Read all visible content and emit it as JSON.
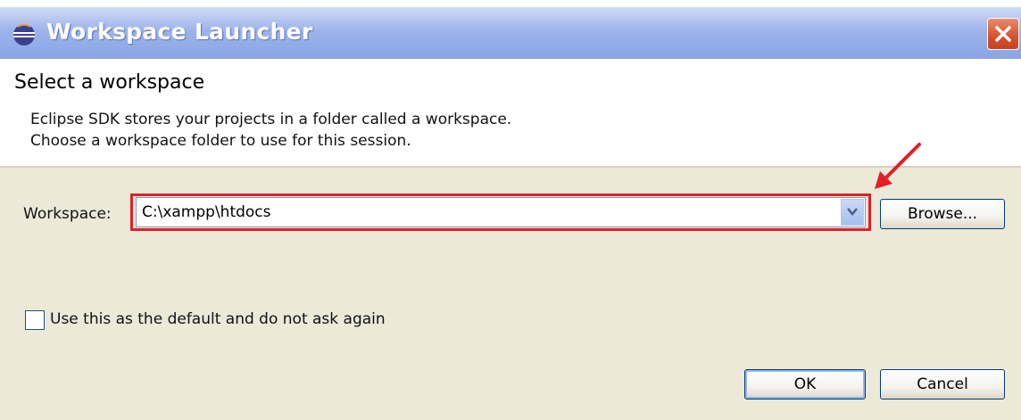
{
  "window": {
    "title": "Workspace Launcher",
    "app_icon": "eclipse-icon",
    "close_icon": "close-icon"
  },
  "header": {
    "title": "Select a workspace",
    "description_line1": "Eclipse SDK stores your projects in a folder called a workspace.",
    "description_line2": "Choose a workspace folder to use for this session."
  },
  "workspace": {
    "label": "Workspace:",
    "value": "C:\\xampp\\htdocs",
    "dropdown_icon": "chevron-down-icon",
    "browse_label": "Browse..."
  },
  "default_option": {
    "label": "Use this as the default and do not ask again",
    "checked": false
  },
  "footer": {
    "ok_label": "OK",
    "cancel_label": "Cancel"
  },
  "annotation": {
    "highlight_color": "#e0202a",
    "arrow_icon": "red-arrow-icon"
  }
}
